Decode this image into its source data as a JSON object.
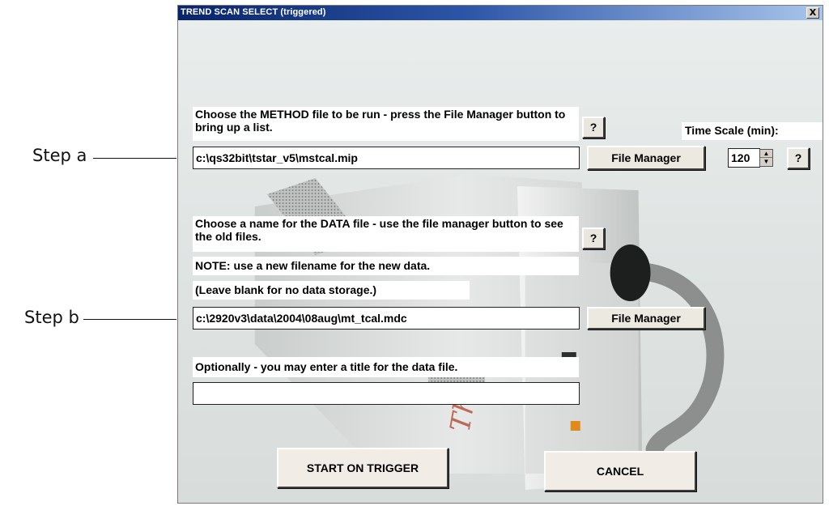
{
  "annotations": {
    "step_a": "Step a",
    "step_b": "Step b"
  },
  "window": {
    "title": "TREND SCAN SELECT (triggered)",
    "close_label": "X"
  },
  "method": {
    "prompt": "Choose the METHOD file to be run - press the File Manager button to bring up a list.",
    "value": "c:\\qs32bit\\tstar_v5\\mstcal.mip",
    "help_label": "?",
    "file_manager_label": "File Manager"
  },
  "time_scale": {
    "label": "Time Scale (min):",
    "value": "120",
    "help_label": "?"
  },
  "data_file": {
    "prompt": "Choose a name for the DATA file - use the file manager button to see the old files.",
    "note": "NOTE: use a new filename for the new data.",
    "blank_note": "(Leave blank for no data storage.)",
    "value": "c:\\2920v3\\data\\2004\\08aug\\mt_tcal.mdc",
    "help_label": "?",
    "file_manager_label": "File Manager"
  },
  "title_field": {
    "prompt": "Optionally - you may enter a title for the data file.",
    "value": ""
  },
  "buttons": {
    "start": "START ON TRIGGER",
    "cancel": "CANCEL"
  },
  "colors": {
    "titlebar_start": "#08246b",
    "titlebar_end": "#a9c5ec",
    "dialog_bg": "#dde2e1"
  }
}
